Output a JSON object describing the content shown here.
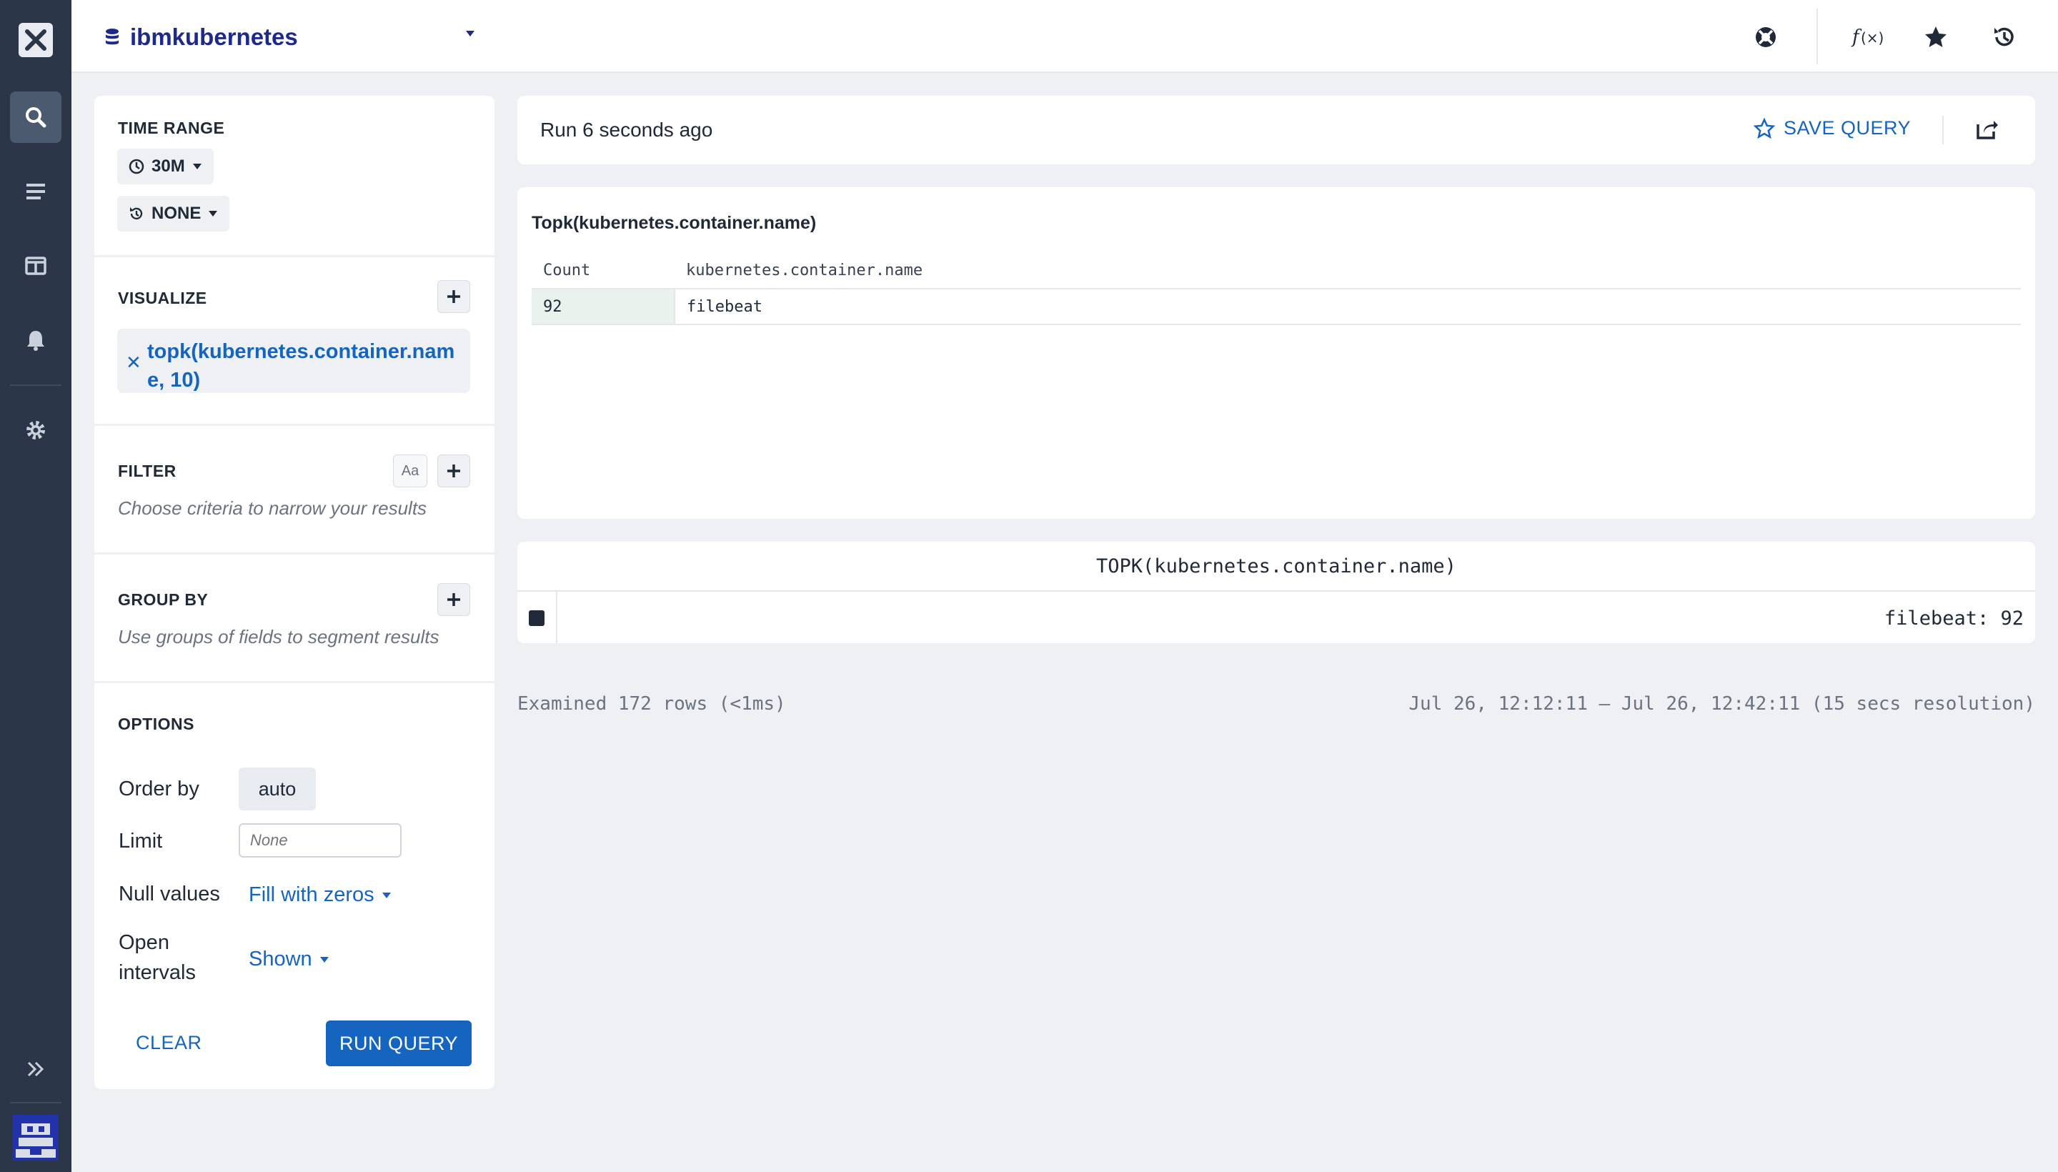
{
  "app": {
    "dataset": "ibmkubernetes"
  },
  "sidebar": {
    "items": [
      "search-icon",
      "datasets-icon",
      "dashboards-icon",
      "alerts-icon",
      "settings-icon"
    ]
  },
  "query": {
    "time_range_title": "TIME RANGE",
    "time_range": "30M",
    "compare": "NONE",
    "visualize_title": "VISUALIZE",
    "visualize_item": "topk(kubernetes.container.name, 10)",
    "filter_title": "FILTER",
    "filter_case": "Aa",
    "filter_hint": "Choose criteria to narrow your results",
    "group_title": "GROUP BY",
    "group_hint": "Use groups of fields to segment results",
    "options_title": "OPTIONS",
    "order_label": "Order by",
    "order_value": "auto",
    "limit_label": "Limit",
    "limit_placeholder": "None",
    "null_label": "Null values",
    "null_value": "Fill with zeros",
    "open_label_1": "Open",
    "open_label_2": "intervals",
    "open_value": "Shown",
    "clear_label": "CLEAR",
    "run_label": "RUN QUERY"
  },
  "run": {
    "status": "Run 6 seconds ago",
    "save_label": "SAVE QUERY"
  },
  "table": {
    "title": "Topk(kubernetes.container.name)",
    "columns": [
      "Count",
      "kubernetes.container.name"
    ],
    "rows": [
      [
        "92",
        "filebeat"
      ]
    ]
  },
  "chart": {
    "title": "TOPK(kubernetes.container.name)",
    "legend_value": "filebeat: 92",
    "series_color": "#1f2937"
  },
  "footer": {
    "examined": "Examined 172 rows (<1ms)",
    "range": "Jul 26, 12:12:11 – Jul 26, 12:42:11 (15 secs resolution)"
  },
  "colors": {
    "accent": "#1565c0",
    "nav_bg": "#2b3648",
    "page_bg": "#eef0f4"
  }
}
